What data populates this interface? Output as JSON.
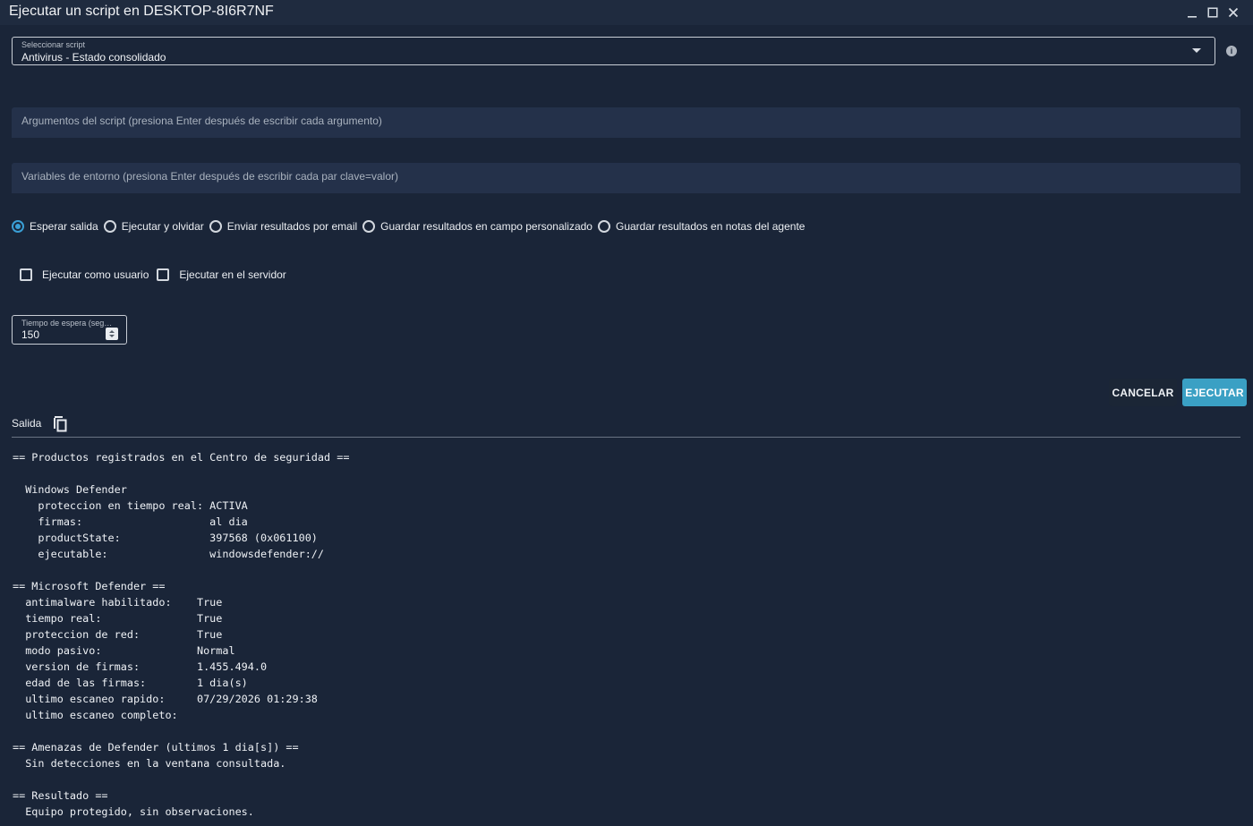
{
  "window": {
    "title": "Ejecutar un script en DESKTOP-8I6R7NF"
  },
  "icons": {
    "minimize": "minimize-icon",
    "maximize": "maximize-icon",
    "close": "close-icon",
    "info": "info-icon",
    "copy": "copy-icon",
    "dropdown": "chevron-down-icon"
  },
  "script_select": {
    "label": "Seleccionar script",
    "value": "Antivirus - Estado consolidado"
  },
  "args_field": {
    "placeholder": "Argumentos del script (presiona Enter después de escribir cada argumento)"
  },
  "env_field": {
    "placeholder": "Variables de entorno (presiona Enter después de escribir cada par clave=valor)"
  },
  "run_mode": {
    "options": [
      {
        "label": "Esperar salida",
        "selected": true
      },
      {
        "label": "Ejecutar y olvidar",
        "selected": false
      },
      {
        "label": "Enviar resultados por email",
        "selected": false
      },
      {
        "label": "Guardar resultados en campo personalizado",
        "selected": false
      },
      {
        "label": "Guardar resultados en notas del agente",
        "selected": false
      }
    ]
  },
  "options": {
    "run_as_user": {
      "label": "Ejecutar como usuario",
      "checked": false
    },
    "run_on_server": {
      "label": "Ejecutar en el servidor",
      "checked": false
    }
  },
  "timeout": {
    "label": "Tiempo de espera (segu...",
    "value": "150"
  },
  "actions": {
    "cancel": "CANCELAR",
    "run": "EJECUTAR"
  },
  "colors": {
    "background": "#1a2538",
    "accent": "#3aa0c4",
    "radio_selected": "#3a9fd6"
  },
  "output": {
    "title": "Salida",
    "lines": [
      "== Productos registrados en el Centro de seguridad ==",
      "",
      "  Windows Defender",
      "    proteccion en tiempo real: ACTIVA",
      "    firmas:                    al dia",
      "    productState:              397568 (0x061100)",
      "    ejecutable:                windowsdefender://",
      "",
      "== Microsoft Defender ==",
      "  antimalware habilitado:    True",
      "  tiempo real:               True",
      "  proteccion de red:         True",
      "  modo pasivo:               Normal",
      "  version de firmas:         1.455.494.0",
      "  edad de las firmas:        1 dia(s)",
      "  ultimo escaneo rapido:     07/29/2026 01:29:38",
      "  ultimo escaneo completo:",
      "",
      "== Amenazas de Defender (ultimos 1 dia[s]) ==",
      "  Sin detecciones en la ventana consultada.",
      "",
      "== Resultado ==",
      "  Equipo protegido, sin observaciones."
    ]
  }
}
